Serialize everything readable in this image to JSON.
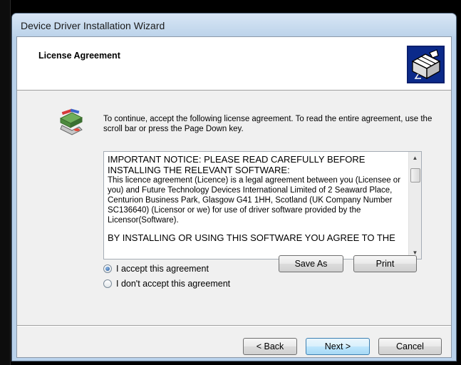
{
  "window": {
    "title": "Device Driver Installation Wizard"
  },
  "header": {
    "title": "License Agreement"
  },
  "intro_text": "To continue, accept the following license agreement. To read the entire agreement, use the scroll bar or press the Page Down key.",
  "license": {
    "heading": "IMPORTANT NOTICE: PLEASE READ CAREFULLY BEFORE INSTALLING THE RELEVANT SOFTWARE:",
    "body": "This licence agreement (Licence) is a legal agreement between you (Licensee or you) and Future Technology Devices International Limited of 2 Seaward Place, Centurion Business Park, Glasgow G41 1HH, Scotland (UK Company Number SC136640) (Licensor or we) for use of driver software provided by the Licensor(Software).",
    "continuation": "BY INSTALLING OR USING THIS SOFTWARE YOU AGREE TO THE"
  },
  "options": {
    "accept_label": "I accept this agreement",
    "decline_label": "I don't accept this agreement",
    "selected": "accept"
  },
  "buttons": {
    "save_as": "Save As",
    "print": "Print",
    "back": "< Back",
    "next": "Next >",
    "cancel": "Cancel"
  }
}
